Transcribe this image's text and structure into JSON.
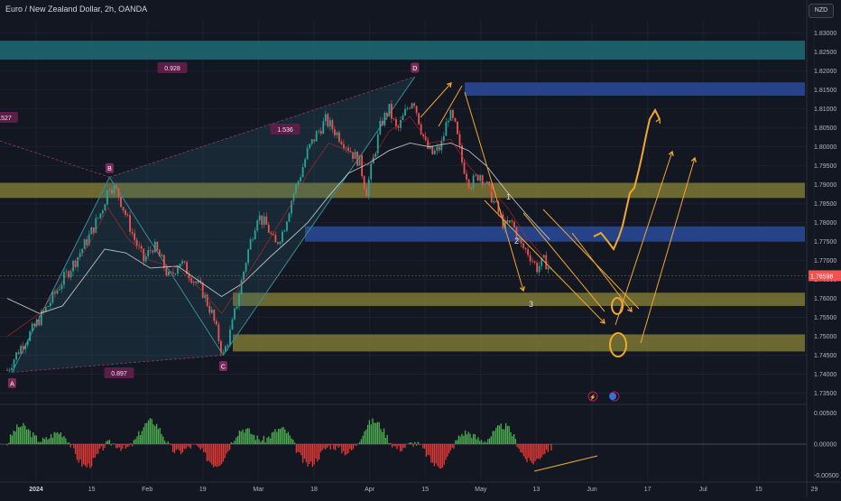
{
  "header": {
    "title": "Euro / New Zealand Dollar, 2h, OANDA",
    "currency_button": "NZD"
  },
  "chart_data": [
    {
      "type": "candlestick",
      "symbol": "EURNZD",
      "timeframe": "2h",
      "x_ticks": [
        "2024",
        "15",
        "Feb",
        "19",
        "Mar",
        "18",
        "Apr",
        "15",
        "May",
        "13",
        "Jun",
        "17",
        "Jul",
        "15",
        "29"
      ],
      "y_ticks": [
        "1.83000",
        "1.82500",
        "1.82000",
        "1.81500",
        "1.81000",
        "1.80500",
        "1.80000",
        "1.79500",
        "1.79000",
        "1.78500",
        "1.78000",
        "1.77500",
        "1.77000",
        "1.76500",
        "1.76000",
        "1.75500",
        "1.75000",
        "1.74500",
        "1.74000",
        "1.73500"
      ],
      "ylim": [
        1.7325,
        1.8335
      ],
      "last_price": "1.76598",
      "close_path": [
        [
          0,
          1.741
        ],
        [
          0.8,
          1.747
        ],
        [
          1.6,
          1.752
        ],
        [
          2.5,
          1.758
        ],
        [
          3.3,
          1.764
        ],
        [
          4.2,
          1.77
        ],
        [
          5,
          1.776
        ],
        [
          5.8,
          1.783
        ],
        [
          6.3,
          1.79
        ],
        [
          6.8,
          1.788
        ],
        [
          7.3,
          1.782
        ],
        [
          7.8,
          1.776
        ],
        [
          8.4,
          1.77
        ],
        [
          9,
          1.774
        ],
        [
          9.5,
          1.77
        ],
        [
          10,
          1.765
        ],
        [
          10.6,
          1.77
        ],
        [
          11.3,
          1.766
        ],
        [
          12,
          1.762
        ],
        [
          12.6,
          1.756
        ],
        [
          13.1,
          1.748
        ],
        [
          13.3,
          1.745
        ],
        [
          13.8,
          1.752
        ],
        [
          14.3,
          1.762
        ],
        [
          14.8,
          1.772
        ],
        [
          15.4,
          1.782
        ],
        [
          16,
          1.779
        ],
        [
          16.5,
          1.774
        ],
        [
          17,
          1.778
        ],
        [
          17.5,
          1.786
        ],
        [
          18,
          1.792
        ],
        [
          18.5,
          1.799
        ],
        [
          19,
          1.803
        ],
        [
          19.6,
          1.807
        ],
        [
          20.2,
          1.804
        ],
        [
          20.8,
          1.801
        ],
        [
          21.3,
          1.798
        ],
        [
          21.7,
          1.796
        ],
        [
          22.1,
          1.788
        ],
        [
          22.6,
          1.798
        ],
        [
          23,
          1.806
        ],
        [
          23.5,
          1.81
        ],
        [
          24,
          1.804
        ],
        [
          24.6,
          1.81
        ],
        [
          25,
          1.813
        ],
        [
          25.4,
          1.806
        ],
        [
          25.8,
          1.8
        ],
        [
          26.2,
          1.798
        ],
        [
          26.7,
          1.8
        ],
        [
          27.2,
          1.809
        ],
        [
          27.6,
          1.805
        ],
        [
          28,
          1.796
        ],
        [
          28.5,
          1.79
        ],
        [
          29.1,
          1.793
        ],
        [
          29.6,
          1.789
        ],
        [
          30.1,
          1.784
        ],
        [
          30.6,
          1.779
        ],
        [
          31.1,
          1.78
        ],
        [
          31.6,
          1.774
        ],
        [
          32.1,
          1.772
        ],
        [
          32.6,
          1.768
        ],
        [
          33.1,
          1.77
        ],
        [
          33.6,
          1.766
        ]
      ],
      "moving_averages": [
        {
          "name": "",
          "color": "#d9d9d9",
          "values": [
            [
              0,
              1.76
            ],
            [
              2,
              1.756
            ],
            [
              3.4,
              1.758
            ],
            [
              4.8,
              1.766
            ],
            [
              6,
              1.773
            ],
            [
              7.3,
              1.772
            ],
            [
              8.8,
              1.768
            ],
            [
              10.5,
              1.7685
            ],
            [
              12,
              1.764
            ],
            [
              13.2,
              1.7605
            ],
            [
              14.5,
              1.764
            ],
            [
              16.2,
              1.771
            ],
            [
              17.5,
              1.776
            ],
            [
              18.5,
              1.78
            ],
            [
              19.8,
              1.787
            ],
            [
              21,
              1.793
            ],
            [
              22.2,
              1.7955
            ],
            [
              23.5,
              1.799
            ],
            [
              24.8,
              1.801
            ],
            [
              26,
              1.8
            ],
            [
              27.3,
              1.801
            ],
            [
              28.4,
              1.799
            ],
            [
              29.5,
              1.795
            ],
            [
              30.8,
              1.788
            ],
            [
              32,
              1.782
            ],
            [
              33.4,
              1.7755
            ]
          ]
        },
        {
          "name": "",
          "color": "#c62828",
          "values": [
            [
              0,
              1.75
            ],
            [
              2,
              1.756
            ],
            [
              3.5,
              1.765
            ],
            [
              5,
              1.774
            ],
            [
              6.2,
              1.784
            ],
            [
              7.4,
              1.776
            ],
            [
              8.8,
              1.77
            ],
            [
              10.5,
              1.768
            ],
            [
              12,
              1.762
            ],
            [
              13.2,
              1.756
            ],
            [
              14.6,
              1.765
            ],
            [
              16.2,
              1.776
            ],
            [
              17.5,
              1.785
            ],
            [
              18.5,
              1.793
            ],
            [
              19.8,
              1.801
            ],
            [
              21,
              1.799
            ],
            [
              22.2,
              1.795
            ],
            [
              23.5,
              1.804
            ],
            [
              24.8,
              1.808
            ],
            [
              26,
              1.801
            ],
            [
              27.3,
              1.802
            ],
            [
              28.4,
              1.795
            ],
            [
              29.5,
              1.79
            ],
            [
              30.8,
              1.784
            ],
            [
              32,
              1.776
            ],
            [
              33.4,
              1.769
            ]
          ]
        }
      ],
      "zones": [
        {
          "color": "teal",
          "low": 1.823,
          "high": 1.828
        },
        {
          "color": "blue",
          "low": 1.8135,
          "high": 1.817
        },
        {
          "color": "olive",
          "low": 1.7865,
          "high": 1.7905
        },
        {
          "color": "blue",
          "low": 1.775,
          "high": 1.779
        },
        {
          "color": "olive",
          "low": 1.758,
          "high": 1.7615
        },
        {
          "color": "olive",
          "low": 1.746,
          "high": 1.7505
        }
      ],
      "harmonic_pattern": {
        "points": [
          {
            "label": "A",
            "x": 0.3,
            "y": 1.7405
          },
          {
            "label": "B",
            "x": 6.3,
            "y": 1.792
          },
          {
            "label": "C",
            "x": 13.3,
            "y": 1.745
          },
          {
            "label": "D",
            "x": 25.1,
            "y": 1.8185
          }
        ],
        "ratios": [
          "0.928",
          "1.536",
          "0.897",
          ".527"
        ]
      },
      "wave_labels": [
        "1",
        "2",
        "3"
      ]
    },
    {
      "type": "histogram",
      "name": "oscillator",
      "y_ticks": [
        "0.00500",
        "0.00000",
        "-0.00500"
      ],
      "ylim": [
        -0.0058,
        0.0058
      ]
    }
  ]
}
